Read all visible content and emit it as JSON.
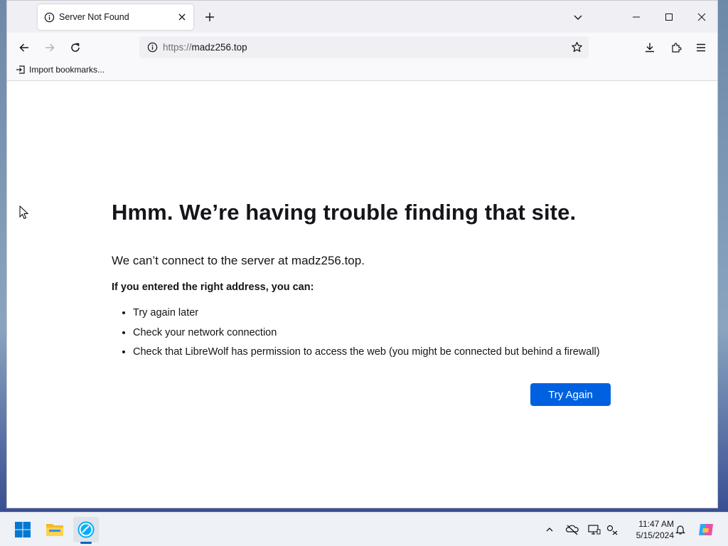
{
  "browser": {
    "tab": {
      "title": "Server Not Found"
    },
    "url": {
      "scheme": "https://",
      "host": "madz256.top"
    },
    "bookmarks_toolbar": {
      "import_label": "Import bookmarks..."
    }
  },
  "error_page": {
    "title": "Hmm. We’re having trouble finding that site.",
    "subtitle": "We can’t connect to the server at madz256.top.",
    "hint": "If you entered the right address, you can:",
    "suggestions": [
      "Try again later",
      "Check your network connection",
      "Check that LibreWolf has permission to access the web (you might be connected but behind a firewall)"
    ],
    "try_again_label": "Try Again"
  },
  "taskbar": {
    "time": "11:47 AM",
    "date": "5/15/2024"
  },
  "colors": {
    "accent": "#0061e0",
    "text": "#15141a"
  },
  "icons": [
    "info-icon",
    "close-icon",
    "plus-icon",
    "chevron-down-icon",
    "minimize-icon",
    "maximize-icon",
    "back-icon",
    "forward-icon",
    "reload-icon",
    "star-icon",
    "download-icon",
    "extensions-icon",
    "menu-icon",
    "import-icon",
    "windows-start-icon",
    "file-explorer-icon",
    "librewolf-icon",
    "chevron-up-icon",
    "network-offline-icon",
    "display-icon",
    "settings-icon",
    "bell-icon",
    "copilot-icon"
  ]
}
